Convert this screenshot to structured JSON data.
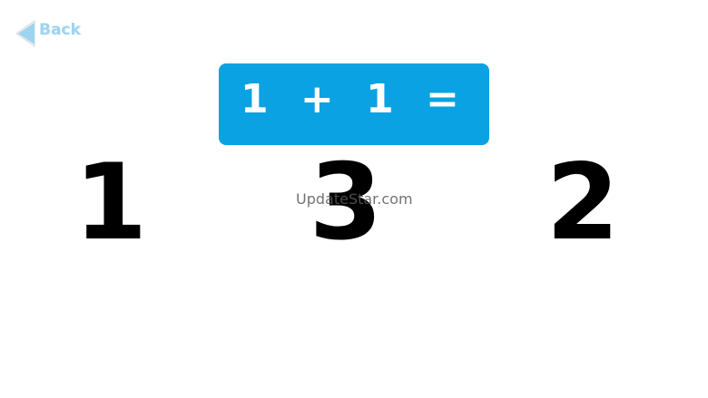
{
  "nav": {
    "back_label": "Back"
  },
  "question": {
    "text": "1 + 1 ="
  },
  "answers": [
    {
      "label": "1"
    },
    {
      "label": "3"
    },
    {
      "label": "2"
    }
  ],
  "watermark": {
    "text": "UpdateStar.com"
  },
  "colors": {
    "question_bg": "#0aa2e3",
    "back_color": "#9fd4ef"
  }
}
